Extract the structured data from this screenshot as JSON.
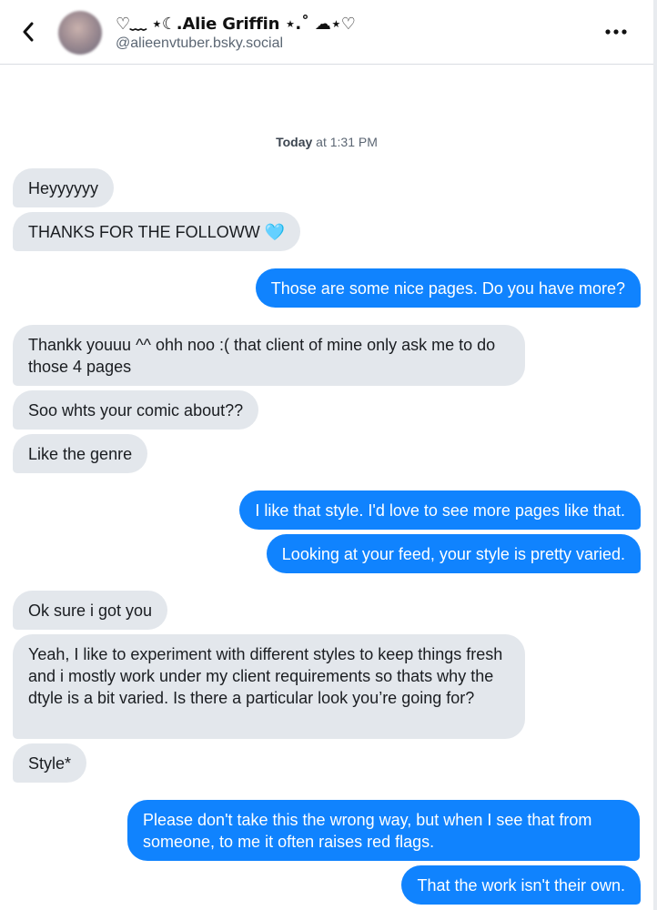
{
  "header": {
    "back_icon": "chevron-left-icon",
    "display_name": "♡︎﹏ ⋆☾.Alie Griffin ⋆.˚ ☁︎⋆♡",
    "handle": "@alieenvtuber.bsky.social",
    "more_icon": "ellipsis-icon"
  },
  "timestamp": {
    "day": "Today",
    "time": " at 1:31 PM"
  },
  "messages": [
    {
      "from": "them",
      "text": "Heyyyyyy"
    },
    {
      "from": "them",
      "text": "THANKS FOR THE FOLLOWW 🩵"
    },
    {
      "from": "me",
      "text": "Those are some nice pages. Do you have more?"
    },
    {
      "from": "them",
      "text": "Thankk youuu ^^ ohh noo :( that client of mine only ask me to do those 4 pages"
    },
    {
      "from": "them",
      "text": "Soo whts your comic about??"
    },
    {
      "from": "them",
      "text": "Like the genre"
    },
    {
      "from": "me",
      "text": "I like that style. I'd love to see more pages like that."
    },
    {
      "from": "me",
      "text": "Looking at your feed, your style is pretty varied."
    },
    {
      "from": "them",
      "text": "Ok sure i got you"
    },
    {
      "from": "them",
      "text": "Yeah, I like to experiment with different styles to keep things fresh and i mostly work under my client requirements so thats why the dtyle is a bit varied. Is there a particular look you’re going for?"
    },
    {
      "from": "them",
      "text": "Style*"
    },
    {
      "from": "me",
      "text": "Please don't take this the wrong way, but when I see that from someone, to me it often raises red flags."
    },
    {
      "from": "me",
      "text": "That the work isn't their own."
    }
  ],
  "colors": {
    "outgoing_bubble": "#1083fe",
    "incoming_bubble": "#e3e7ec"
  }
}
